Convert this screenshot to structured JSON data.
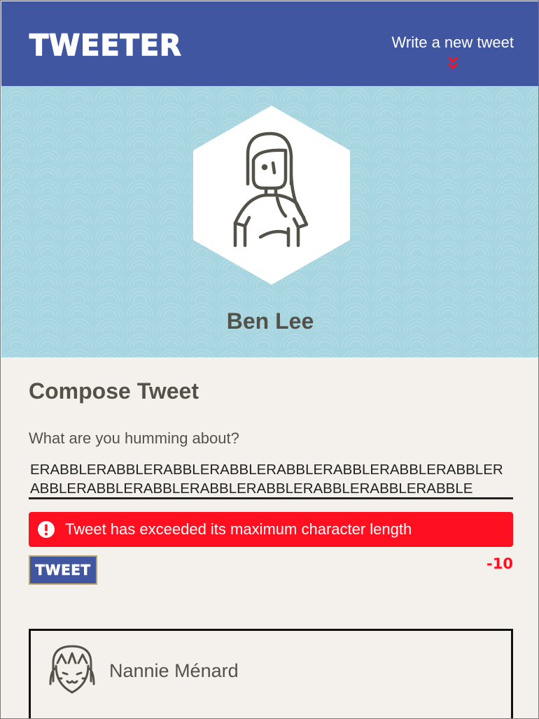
{
  "header": {
    "brand": "TWEETER",
    "write_link": "Write a new tweet",
    "write_link_icon": "double-chevron-down-icon"
  },
  "profile": {
    "name": "Ben Lee",
    "avatar_icon": "woman-avatar-icon"
  },
  "compose": {
    "title": "Compose Tweet",
    "prompt": "What are you humming about?",
    "text_value": "ERABBLERABBLERABBLERABBLERABBLERABBLERABBLERABBLERABBLERABBLERABBLERABBLERABBLERABBLERABBLERABBLE",
    "error_message": "Tweet has exceeded its maximum character length",
    "error_icon": "exclamation-circle-icon",
    "tweet_button": "TWEET",
    "counter": "-10"
  },
  "tweets": [
    {
      "author": "Nannie Ménard",
      "avatar_icon": "girl-avatar-icon"
    }
  ],
  "colors": {
    "nav": "#4056a1",
    "hero": "#a7d5e0",
    "background": "#f4f1ec",
    "error": "#ff1021",
    "text": "#545149"
  }
}
